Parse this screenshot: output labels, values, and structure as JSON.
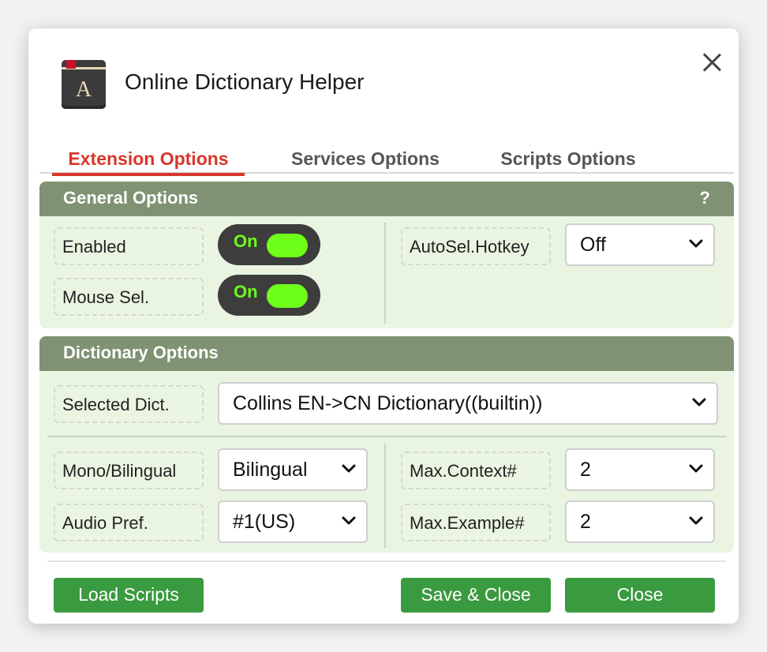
{
  "app": {
    "title": "Online Dictionary Helper",
    "icon_letter": "A"
  },
  "tabs": [
    {
      "label": "Extension Options",
      "active": true
    },
    {
      "label": "Services Options",
      "active": false
    },
    {
      "label": "Scripts Options",
      "active": false
    }
  ],
  "general": {
    "title": "General Options",
    "help": "?",
    "enabled_label": "Enabled",
    "enabled_state": "On",
    "mouse_sel_label": "Mouse Sel.",
    "mouse_sel_state": "On",
    "autosel_label": "AutoSel.Hotkey",
    "autosel_value": "Off"
  },
  "dictionary": {
    "title": "Dictionary Options",
    "selected_dict_label": "Selected Dict.",
    "selected_dict_value": "Collins EN->CN Dictionary((builtin))",
    "mono_bilingual_label": "Mono/Bilingual",
    "mono_bilingual_value": "Bilingual",
    "audio_pref_label": "Audio Pref.",
    "audio_pref_value": "#1(US)",
    "max_context_label": "Max.Context#",
    "max_context_value": "2",
    "max_example_label": "Max.Example#",
    "max_example_value": "2"
  },
  "footer": {
    "load_scripts": "Load Scripts",
    "save_close": "Save & Close",
    "close": "Close"
  },
  "colors": {
    "accent_red": "#d7362a",
    "section_header": "#7f9273",
    "section_bg": "#eaf5e1",
    "toggle_on": "#6dff1a",
    "button_green": "#3a9a3f"
  }
}
